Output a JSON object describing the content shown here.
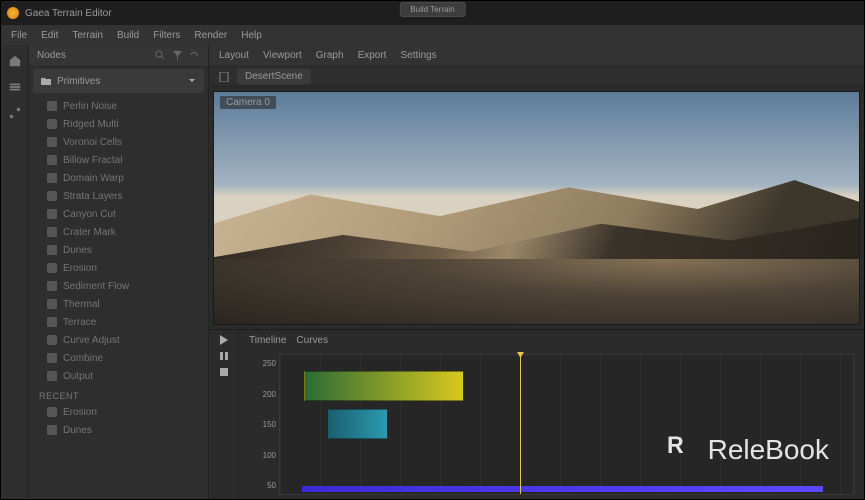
{
  "title": "Gaea Terrain Editor",
  "menu": [
    "File",
    "Edit",
    "Terrain",
    "Build",
    "Filters",
    "Render",
    "Help"
  ],
  "top_tab": "Build Terrain",
  "sidebar": {
    "head": "Nodes",
    "folder": "Primitives",
    "items": [
      "Perlin Noise",
      "Ridged Multi",
      "Voronoi Cells",
      "Billow Fractal",
      "Domain Warp",
      "Strata Layers",
      "Canyon Cut",
      "Crater Mark",
      "Dunes",
      "Erosion",
      "Sediment Flow",
      "Thermal",
      "Terrace",
      "Curve Adjust",
      "Combine",
      "Output"
    ],
    "section2": "Recent",
    "recent": [
      "Erosion",
      "Dunes"
    ]
  },
  "toolrow": [
    "Layout",
    "Viewport",
    "Graph",
    "Export",
    "Settings"
  ],
  "crumb": "DesertScene",
  "viewport_label": "Camera 0",
  "timeline": {
    "head_items": [
      "Timeline",
      "Curves"
    ],
    "y": [
      "250",
      "200",
      "150",
      "100",
      "50"
    ]
  },
  "watermark": "ReleBook"
}
